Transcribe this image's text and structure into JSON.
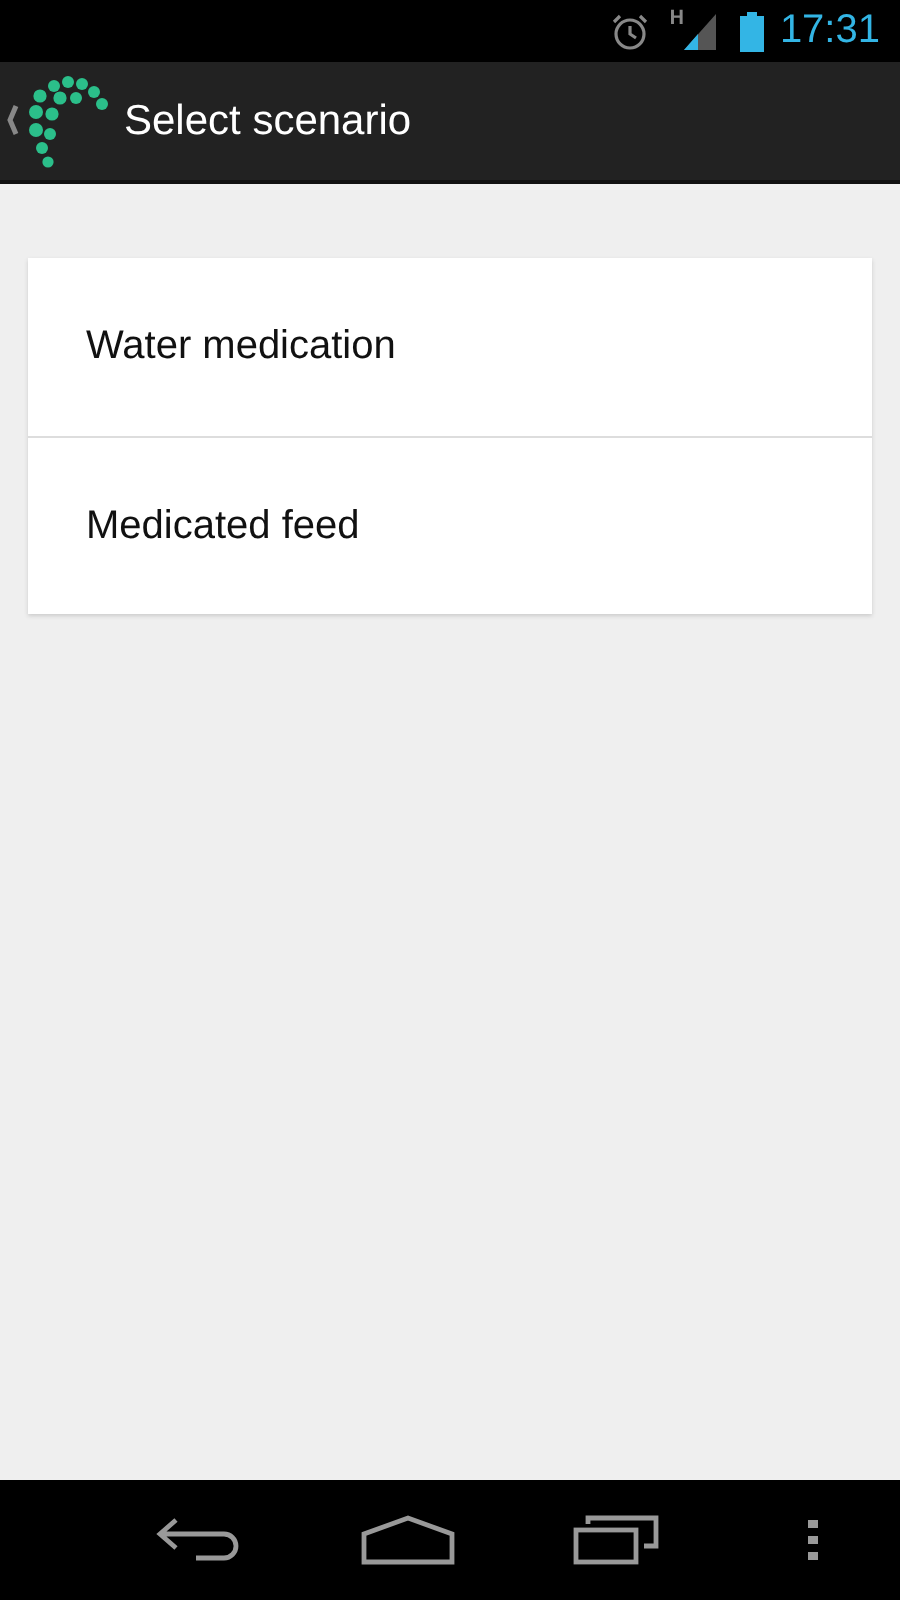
{
  "status_bar": {
    "time": "17:31",
    "network_type": "H"
  },
  "action_bar": {
    "title": "Select scenario"
  },
  "scenarios": [
    {
      "label": "Water medication"
    },
    {
      "label": "Medicated feed"
    }
  ]
}
